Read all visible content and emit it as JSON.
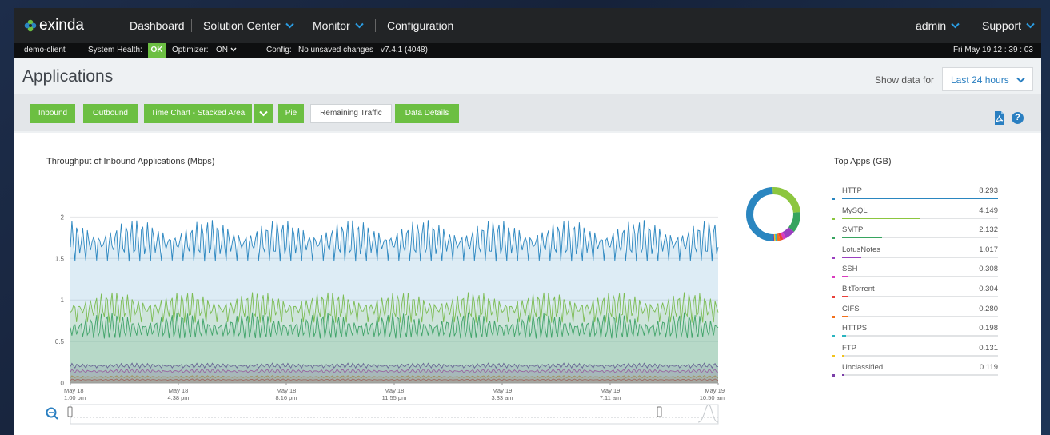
{
  "nav": {
    "brand": "exinda",
    "items": [
      "Dashboard",
      "Solution Center",
      "Monitor",
      "Configuration"
    ],
    "user": "admin",
    "support": "Support"
  },
  "status": {
    "client": "demo-client",
    "health_label": "System Health:",
    "health_value": "OK",
    "optimizer_label": "Optimizer:",
    "optimizer_value": "ON",
    "config_label": "Config:",
    "config_value": "No unsaved changes",
    "version": "v7.4.1 (4048)",
    "datetime": "Fri May 19 12 : 39 : 03"
  },
  "page": {
    "title": "Applications",
    "show_label": "Show data for",
    "range": "Last 24 hours"
  },
  "toolbar": {
    "inbound": "Inbound",
    "outbound": "Outbound",
    "time_chart": "Time Chart - Stacked Area",
    "pie": "Pie",
    "remaining": "Remaining Traffic",
    "details": "Data Details"
  },
  "chart_data": {
    "type": "area",
    "title": "Throughput of Inbound Applications (Mbps)",
    "ylim": [
      0,
      2.1
    ],
    "yticks": [
      "0",
      "0.5",
      "1",
      "1.5",
      "2"
    ],
    "xticks": [
      {
        "date": "May 18",
        "time": "1:00 pm"
      },
      {
        "date": "May 18",
        "time": "4:38 pm"
      },
      {
        "date": "May 18",
        "time": "8:16 pm"
      },
      {
        "date": "May 18",
        "time": "11:55 pm"
      },
      {
        "date": "May 19",
        "time": "3:33 am"
      },
      {
        "date": "May 19",
        "time": "7:11 am"
      },
      {
        "date": "May 19",
        "time": "10:50 am"
      }
    ],
    "series_colors": [
      "#e8413b",
      "#f2a31c",
      "#d93cc0",
      "#7b3fa8",
      "#37a45f",
      "#8cc63f",
      "#2a86c0"
    ],
    "bands": [
      {
        "base": 0.03,
        "amp": 0.02,
        "color": "#e8413b"
      },
      {
        "base": 0.06,
        "amp": 0.03,
        "color": "#f2a31c"
      },
      {
        "base": 0.12,
        "amp": 0.05,
        "color": "#d93cc0"
      },
      {
        "base": 0.18,
        "amp": 0.06,
        "color": "#7b3fa8"
      },
      {
        "base": 0.5,
        "amp": 0.35,
        "color": "#37a45f"
      },
      {
        "base": 0.72,
        "amp": 0.38,
        "color": "#8cc63f"
      },
      {
        "base": 1.45,
        "amp": 0.52,
        "color": "#2a86c0"
      }
    ],
    "cycles": 60
  },
  "top_apps": {
    "title": "Top Apps (GB)",
    "apps": [
      {
        "name": "HTTP",
        "value": "8.293",
        "num": 8.293,
        "color": "#2a86c0"
      },
      {
        "name": "MySQL",
        "value": "4.149",
        "num": 4.149,
        "color": "#8cc63f"
      },
      {
        "name": "SMTP",
        "value": "2.132",
        "num": 2.132,
        "color": "#37a45f"
      },
      {
        "name": "LotusNotes",
        "value": "1.017",
        "num": 1.017,
        "color": "#9b3fc0"
      },
      {
        "name": "SSH",
        "value": "0.308",
        "num": 0.308,
        "color": "#d93cc0"
      },
      {
        "name": "BitTorrent",
        "value": "0.304",
        "num": 0.304,
        "color": "#e8413b"
      },
      {
        "name": "CIFS",
        "value": "0.280",
        "num": 0.28,
        "color": "#f2711c"
      },
      {
        "name": "HTTPS",
        "value": "0.198",
        "num": 0.198,
        "color": "#2ab5c0"
      },
      {
        "name": "FTP",
        "value": "0.131",
        "num": 0.131,
        "color": "#f2c31c"
      },
      {
        "name": "Unclassified",
        "value": "0.119",
        "num": 0.119,
        "color": "#7b3fa8"
      }
    ]
  }
}
